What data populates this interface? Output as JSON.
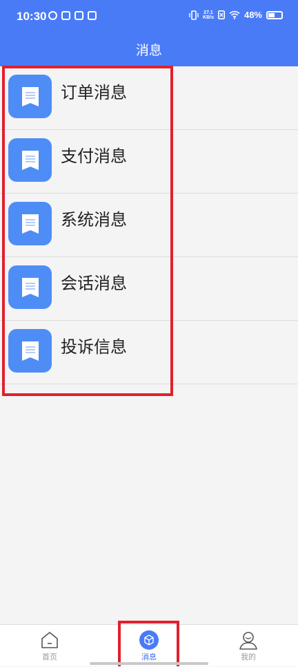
{
  "status_bar": {
    "time": "10:30",
    "net_speed_value": "27.1",
    "net_speed_unit": "KB/s",
    "battery": "48%"
  },
  "header": {
    "title": "消息"
  },
  "messages": [
    {
      "label": "订单消息",
      "icon": "document-icon"
    },
    {
      "label": "支付消息",
      "icon": "document-icon"
    },
    {
      "label": "系统消息",
      "icon": "document-icon"
    },
    {
      "label": "会话消息",
      "icon": "document-icon"
    },
    {
      "label": "投诉信息",
      "icon": "document-icon"
    }
  ],
  "tabbar": {
    "tabs": [
      {
        "label": "首页",
        "icon": "home-icon",
        "active": false
      },
      {
        "label": "消息",
        "icon": "cube-icon",
        "active": true
      },
      {
        "label": "我的",
        "icon": "user-icon",
        "active": false
      }
    ]
  },
  "colors": {
    "header": "#4a7bf7",
    "icon_bg": "#4f8df6",
    "highlight": "#e0202d",
    "active_tab": "#3a6ee8"
  }
}
